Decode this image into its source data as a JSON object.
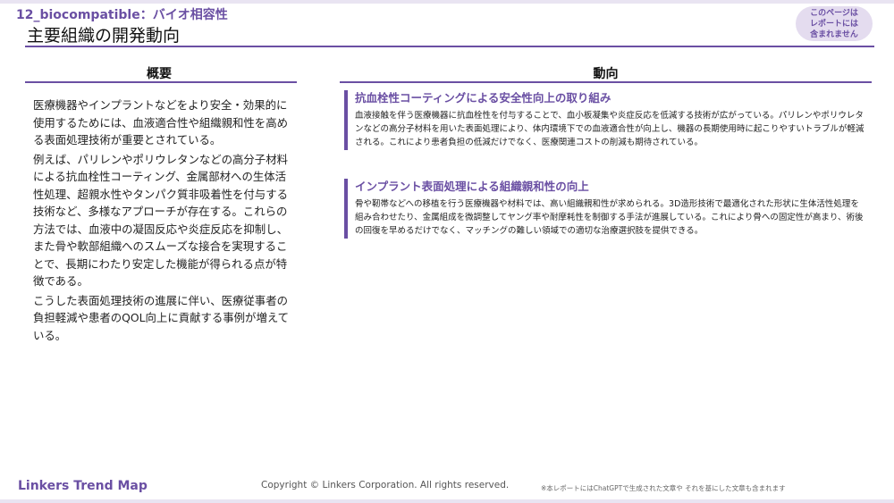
{
  "header": {
    "code": "12_biocompatible：バイオ相容性",
    "title": "主要組織の開発動向"
  },
  "badge": {
    "lines": [
      "このページは",
      "レポートには",
      "含まれません"
    ]
  },
  "overview": {
    "heading": "概要",
    "paragraphs": [
      "医療機器やインプラントなどをより安全・効果的に使用するためには、血液適合性や組織親和性を高める表面処理技術が重要とされている。",
      "例えば、パリレンやポリウレタンなどの高分子材料による抗血栓性コーティング、金属部材への生体活性処理、超親水性やタンパク質非吸着性を付与する技術など、多様なアプローチが存在する。これらの方法では、血液中の凝固反応や炎症反応を抑制し、また骨や軟部組織へのスムーズな接合を実現することで、長期にわたり安定した機能が得られる点が特徴である。",
      "こうした表面処理技術の進展に伴い、医療従事者の負担軽減や患者のQOL向上に貢献する事例が増えている。"
    ]
  },
  "trends": {
    "heading": "動向",
    "items": [
      {
        "title": "抗血栓性コーティングによる安全性向上の取り組み",
        "body": "血液接触を伴う医療機器に抗血栓性を付与することで、血小板凝集や炎症反応を低減する技術が広がっている。パリレンやポリウレタンなどの高分子材料を用いた表面処理により、体内環境下での血液適合性が向上し、機器の長期使用時に起こりやすいトラブルが軽減される。これにより患者負担の低減だけでなく、医療関連コストの削減も期待されている。"
      },
      {
        "title": "インプラント表面処理による組織親和性の向上",
        "body": "骨や靭帯などへの移植を行う医療機器や材料では、高い組織親和性が求められる。3D造形技術で最適化された形状に生体活性処理を組み合わせたり、金属組成を微調整してヤング率や耐摩耗性を制御する手法が進展している。これにより骨への固定性が高まり、術後の回復を早めるだけでなく、マッチングの難しい領域での適切な治療選択肢を提供できる。"
      }
    ]
  },
  "footer": {
    "logo": "Linkers Trend Map",
    "copyright": "Copyright © Linkers Corporation. All rights reserved.",
    "disclaimer": "※本レポートにはChatGPTで生成された文章や それを基にした文章も含まれます"
  }
}
